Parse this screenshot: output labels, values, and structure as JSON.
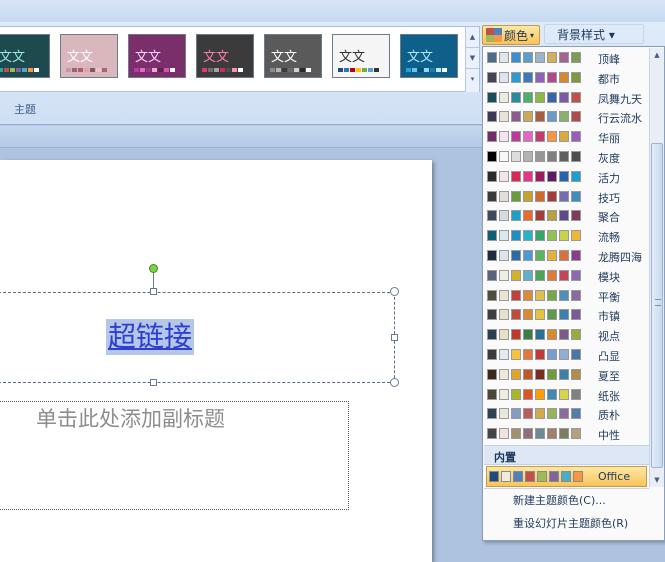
{
  "ribbon": {
    "group_label": "主题",
    "colors_button": "颜色",
    "background_style_button": "背景样式",
    "theme_thumbnails": [
      {
        "text": "文文",
        "bg": "#1c4a4d",
        "fg": "#9ee7e8",
        "swatches": [
          "#2aa6a8",
          "#c0504d",
          "#9bbb59",
          "#8064a2",
          "#4bacc6",
          "#f79646",
          "#ffffff"
        ]
      },
      {
        "text": "文文",
        "bg": "#d9b7bd",
        "fg": "#ffffff",
        "swatches": [
          "#c29aa2",
          "#8d6b7a",
          "#b25d6b",
          "#dba5ad",
          "#7d5a66",
          "#e6c9ce",
          "#a46674"
        ]
      },
      {
        "text": "文文",
        "bg": "#7a2f6a",
        "fg": "#ffd4f3",
        "swatches": [
          "#b83b9c",
          "#e268c4",
          "#8c3a8a",
          "#f0a6db",
          "#5c2456",
          "#d94fb2",
          "#ffffff"
        ]
      },
      {
        "text": "文文",
        "bg": "#3b3b3b",
        "fg": "#ff7ab0",
        "swatches": [
          "#e4357a",
          "#6f6f6f",
          "#a3a3a3",
          "#cc2a63",
          "#4d4d4d",
          "#ff8fb8",
          "#ffffff"
        ]
      },
      {
        "text": "文文",
        "bg": "#5a5a5a",
        "fg": "#ffffff",
        "swatches": [
          "#8b8b8b",
          "#b3b3b3",
          "#3c3c3c",
          "#6b6b6b",
          "#d1d1d1",
          "#2a2a2a",
          "#ffffff"
        ]
      },
      {
        "text": "文文",
        "bg": "#f5f5f5",
        "fg": "#333333",
        "swatches": [
          "#1f4e79",
          "#2e75b6",
          "#c00000",
          "#ffc000",
          "#70ad47",
          "#5b9bd5",
          "#333333"
        ]
      },
      {
        "text": "文文",
        "bg": "#0e5f8a",
        "fg": "#aee6ff",
        "swatches": [
          "#26a0da",
          "#68c4ef",
          "#0b4f73",
          "#92d7f7",
          "#1b7eb0",
          "#c6ecfc",
          "#ffffff"
        ]
      }
    ]
  },
  "slide": {
    "title_text": "超链接",
    "subtitle_placeholder": "单击此处添加副标题"
  },
  "color_menu": {
    "themes": [
      {
        "name": "顶峰",
        "colors": [
          "#4f6b8c",
          "#dfe6ee",
          "#3b8fd0",
          "#5aa0c9",
          "#9db2cb",
          "#d0b05d",
          "#a56290",
          "#7c9c52"
        ]
      },
      {
        "name": "都市",
        "colors": [
          "#424456",
          "#dee5ed",
          "#2d9ad0",
          "#3f7ab8",
          "#8c63b7",
          "#b1498e",
          "#d7872e",
          "#7e9a3f"
        ]
      },
      {
        "name": "凤舞九天",
        "colors": [
          "#1a4f5a",
          "#e9ece0",
          "#2b8a9c",
          "#4eaf68",
          "#8cb84a",
          "#3a64a8",
          "#7b5aa8",
          "#c0504d"
        ]
      },
      {
        "name": "行云流水",
        "colors": [
          "#3b3a56",
          "#e9e4d7",
          "#8e5a8c",
          "#c9a857",
          "#a75e3d",
          "#6b9ac4",
          "#8ab06e",
          "#b14a4a"
        ]
      },
      {
        "name": "华丽",
        "colors": [
          "#732c68",
          "#f4e4ef",
          "#b83b9c",
          "#e268c4",
          "#c53b6e",
          "#f79646",
          "#d9a93f",
          "#9a5cb8"
        ]
      },
      {
        "name": "灰度",
        "colors": [
          "#000000",
          "#f8f8f8",
          "#dddddd",
          "#b2b2b2",
          "#969696",
          "#808080",
          "#5f5f5f",
          "#4d4d4d"
        ]
      },
      {
        "name": "活力",
        "colors": [
          "#2b2b2b",
          "#f1e4ed",
          "#d8285a",
          "#e63486",
          "#9e1a5e",
          "#5a1b63",
          "#2563b3",
          "#1d9fd6"
        ]
      },
      {
        "name": "技巧",
        "colors": [
          "#3a3a3a",
          "#e1dfd8",
          "#6b9c3c",
          "#c6a32e",
          "#d4672b",
          "#a33a3a",
          "#756db3",
          "#3f8bc2"
        ]
      },
      {
        "name": "聚合",
        "colors": [
          "#3c4b5c",
          "#d7dce1",
          "#1ba0c8",
          "#e56d2b",
          "#a43c3c",
          "#b9a044",
          "#5a4a8a",
          "#7d3a5a"
        ]
      },
      {
        "name": "流畅",
        "colors": [
          "#0f5e73",
          "#dce9ec",
          "#1d8fc4",
          "#23b4c8",
          "#36a56a",
          "#8fc24f",
          "#c7d34a",
          "#eeb738"
        ]
      },
      {
        "name": "龙腾四海",
        "colors": [
          "#1f2a3c",
          "#dde4ec",
          "#2b6ba9",
          "#4a9ad6",
          "#5cb45c",
          "#e3b13c",
          "#d6723a",
          "#8a3c8a"
        ]
      },
      {
        "name": "模块",
        "colors": [
          "#5a6378",
          "#f0eee7",
          "#d3b12c",
          "#5eb0c6",
          "#4ca35a",
          "#e07a3a",
          "#c6445a",
          "#8a6ab3"
        ]
      },
      {
        "name": "平衡",
        "colors": [
          "#4d4d3d",
          "#eae4d5",
          "#c0423c",
          "#d98a3a",
          "#dcc14d",
          "#7aa64b",
          "#4b8fba",
          "#8a6b9c"
        ]
      },
      {
        "name": "市镇",
        "colors": [
          "#3e3e3e",
          "#e8e1d0",
          "#c14b3a",
          "#d78a2f",
          "#e8c13a",
          "#5e9a4d",
          "#3d7fae",
          "#7a5a9a"
        ]
      },
      {
        "name": "视点",
        "colors": [
          "#2c3e50",
          "#e8e1c9",
          "#c0392b",
          "#3a7d44",
          "#2a6f97",
          "#d68a2e",
          "#7d5a8a",
          "#9aab3a"
        ]
      },
      {
        "name": "凸显",
        "colors": [
          "#3b3b3b",
          "#e4e9f0",
          "#f7c23f",
          "#e3763a",
          "#c03a3a",
          "#7a9cd1",
          "#8eb0d8",
          "#4a76a8"
        ]
      },
      {
        "name": "夏至",
        "colors": [
          "#3a2a1c",
          "#efe8d8",
          "#e0a32e",
          "#c2582a",
          "#7b2e1f",
          "#6f9b3c",
          "#3f7fa8",
          "#b18c4b"
        ]
      },
      {
        "name": "纸张",
        "colors": [
          "#4a4536",
          "#f0ece0",
          "#a6b727",
          "#df5327",
          "#fe9e00",
          "#418ab3",
          "#d7d447",
          "#818183"
        ]
      },
      {
        "name": "质朴",
        "colors": [
          "#2e4052",
          "#e9e6dd",
          "#879cc4",
          "#ba5c5c",
          "#d4a84b",
          "#97b35c",
          "#8a6b9c",
          "#4f7ea8"
        ]
      },
      {
        "name": "中性",
        "colors": [
          "#454545",
          "#efe5dc",
          "#a38f6e",
          "#8f6f7a",
          "#6d8a94",
          "#a1806d",
          "#7e7e5e",
          "#b4a080"
        ]
      }
    ],
    "builtin_header": "内置",
    "office": {
      "name": "Office",
      "colors": [
        "#1f497d",
        "#eeece1",
        "#4f81bd",
        "#c0504d",
        "#9bbb59",
        "#8064a2",
        "#4bacc6",
        "#f79646"
      ]
    },
    "new_theme_colors": "新建主题颜色(C)...",
    "reset_colors": "重设幻灯片主题颜色(R)"
  }
}
